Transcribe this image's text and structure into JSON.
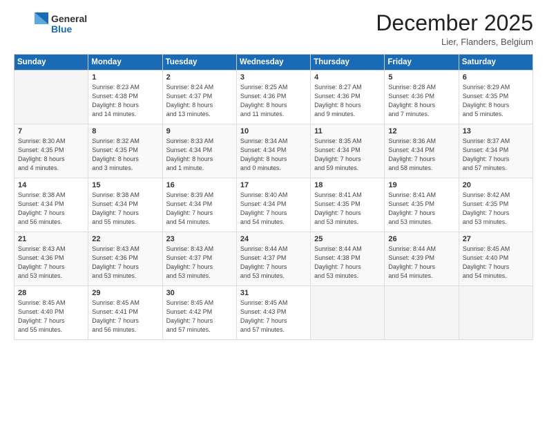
{
  "logo": {
    "line1": "General",
    "line2": "Blue"
  },
  "header": {
    "month": "December 2025",
    "location": "Lier, Flanders, Belgium"
  },
  "days_of_week": [
    "Sunday",
    "Monday",
    "Tuesday",
    "Wednesday",
    "Thursday",
    "Friday",
    "Saturday"
  ],
  "weeks": [
    [
      {
        "day": "",
        "info": ""
      },
      {
        "day": "1",
        "info": "Sunrise: 8:23 AM\nSunset: 4:38 PM\nDaylight: 8 hours\nand 14 minutes."
      },
      {
        "day": "2",
        "info": "Sunrise: 8:24 AM\nSunset: 4:37 PM\nDaylight: 8 hours\nand 13 minutes."
      },
      {
        "day": "3",
        "info": "Sunrise: 8:25 AM\nSunset: 4:36 PM\nDaylight: 8 hours\nand 11 minutes."
      },
      {
        "day": "4",
        "info": "Sunrise: 8:27 AM\nSunset: 4:36 PM\nDaylight: 8 hours\nand 9 minutes."
      },
      {
        "day": "5",
        "info": "Sunrise: 8:28 AM\nSunset: 4:36 PM\nDaylight: 8 hours\nand 7 minutes."
      },
      {
        "day": "6",
        "info": "Sunrise: 8:29 AM\nSunset: 4:35 PM\nDaylight: 8 hours\nand 5 minutes."
      }
    ],
    [
      {
        "day": "7",
        "info": "Sunrise: 8:30 AM\nSunset: 4:35 PM\nDaylight: 8 hours\nand 4 minutes."
      },
      {
        "day": "8",
        "info": "Sunrise: 8:32 AM\nSunset: 4:35 PM\nDaylight: 8 hours\nand 3 minutes."
      },
      {
        "day": "9",
        "info": "Sunrise: 8:33 AM\nSunset: 4:34 PM\nDaylight: 8 hours\nand 1 minute."
      },
      {
        "day": "10",
        "info": "Sunrise: 8:34 AM\nSunset: 4:34 PM\nDaylight: 8 hours\nand 0 minutes."
      },
      {
        "day": "11",
        "info": "Sunrise: 8:35 AM\nSunset: 4:34 PM\nDaylight: 7 hours\nand 59 minutes."
      },
      {
        "day": "12",
        "info": "Sunrise: 8:36 AM\nSunset: 4:34 PM\nDaylight: 7 hours\nand 58 minutes."
      },
      {
        "day": "13",
        "info": "Sunrise: 8:37 AM\nSunset: 4:34 PM\nDaylight: 7 hours\nand 57 minutes."
      }
    ],
    [
      {
        "day": "14",
        "info": "Sunrise: 8:38 AM\nSunset: 4:34 PM\nDaylight: 7 hours\nand 56 minutes."
      },
      {
        "day": "15",
        "info": "Sunrise: 8:38 AM\nSunset: 4:34 PM\nDaylight: 7 hours\nand 55 minutes."
      },
      {
        "day": "16",
        "info": "Sunrise: 8:39 AM\nSunset: 4:34 PM\nDaylight: 7 hours\nand 54 minutes."
      },
      {
        "day": "17",
        "info": "Sunrise: 8:40 AM\nSunset: 4:34 PM\nDaylight: 7 hours\nand 54 minutes."
      },
      {
        "day": "18",
        "info": "Sunrise: 8:41 AM\nSunset: 4:35 PM\nDaylight: 7 hours\nand 53 minutes."
      },
      {
        "day": "19",
        "info": "Sunrise: 8:41 AM\nSunset: 4:35 PM\nDaylight: 7 hours\nand 53 minutes."
      },
      {
        "day": "20",
        "info": "Sunrise: 8:42 AM\nSunset: 4:35 PM\nDaylight: 7 hours\nand 53 minutes."
      }
    ],
    [
      {
        "day": "21",
        "info": "Sunrise: 8:43 AM\nSunset: 4:36 PM\nDaylight: 7 hours\nand 53 minutes."
      },
      {
        "day": "22",
        "info": "Sunrise: 8:43 AM\nSunset: 4:36 PM\nDaylight: 7 hours\nand 53 minutes."
      },
      {
        "day": "23",
        "info": "Sunrise: 8:43 AM\nSunset: 4:37 PM\nDaylight: 7 hours\nand 53 minutes."
      },
      {
        "day": "24",
        "info": "Sunrise: 8:44 AM\nSunset: 4:37 PM\nDaylight: 7 hours\nand 53 minutes."
      },
      {
        "day": "25",
        "info": "Sunrise: 8:44 AM\nSunset: 4:38 PM\nDaylight: 7 hours\nand 53 minutes."
      },
      {
        "day": "26",
        "info": "Sunrise: 8:44 AM\nSunset: 4:39 PM\nDaylight: 7 hours\nand 54 minutes."
      },
      {
        "day": "27",
        "info": "Sunrise: 8:45 AM\nSunset: 4:40 PM\nDaylight: 7 hours\nand 54 minutes."
      }
    ],
    [
      {
        "day": "28",
        "info": "Sunrise: 8:45 AM\nSunset: 4:40 PM\nDaylight: 7 hours\nand 55 minutes."
      },
      {
        "day": "29",
        "info": "Sunrise: 8:45 AM\nSunset: 4:41 PM\nDaylight: 7 hours\nand 56 minutes."
      },
      {
        "day": "30",
        "info": "Sunrise: 8:45 AM\nSunset: 4:42 PM\nDaylight: 7 hours\nand 57 minutes."
      },
      {
        "day": "31",
        "info": "Sunrise: 8:45 AM\nSunset: 4:43 PM\nDaylight: 7 hours\nand 57 minutes."
      },
      {
        "day": "",
        "info": ""
      },
      {
        "day": "",
        "info": ""
      },
      {
        "day": "",
        "info": ""
      }
    ]
  ]
}
